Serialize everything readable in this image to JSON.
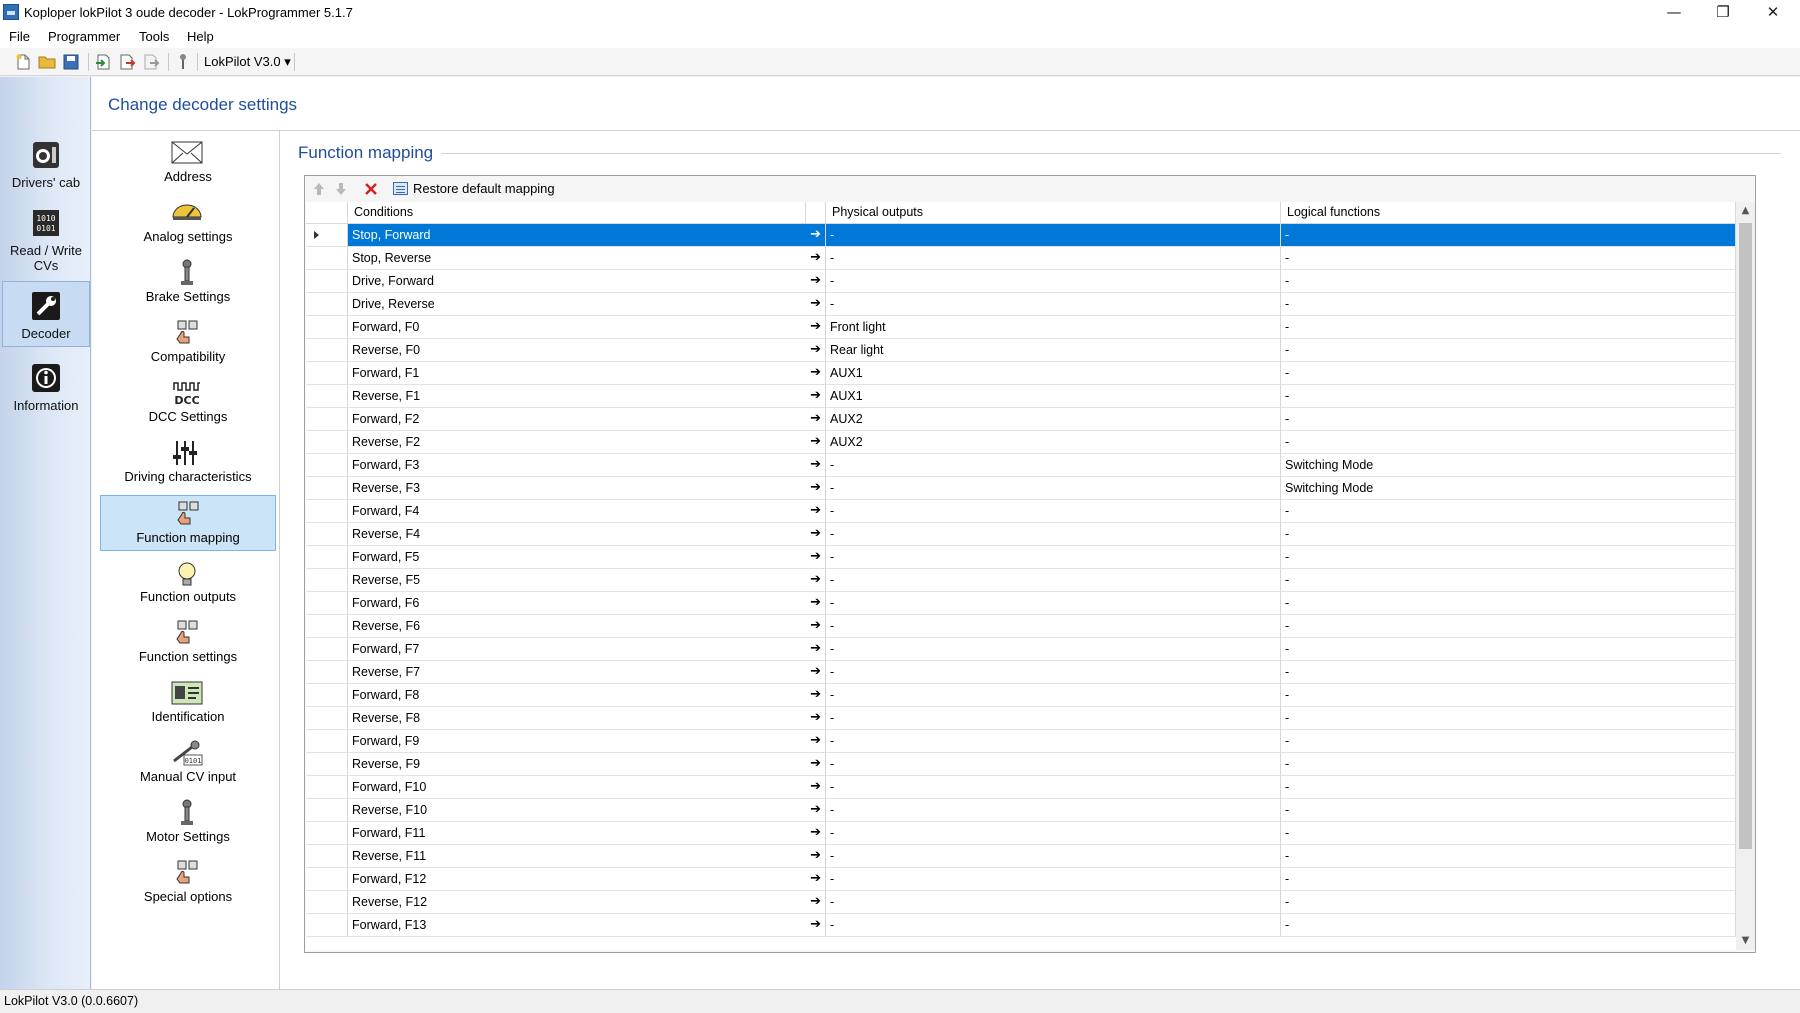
{
  "window": {
    "title": "Koploper lokPilot 3 oude decoder - LokProgrammer 5.1.7",
    "controls": {
      "minimize": "—",
      "restore": "❐",
      "close": "✕"
    }
  },
  "menu": [
    "File",
    "Programmer",
    "Tools",
    "Help"
  ],
  "toolbar": {
    "device_label": "LokPilot V3.0 ▾"
  },
  "leftbar": [
    {
      "label": "Drivers' cab",
      "icon": "drivers-cab-icon"
    },
    {
      "label": "Read / Write CVs",
      "icon": "read-write-cvs-icon"
    },
    {
      "label": "Decoder",
      "icon": "decoder-wrench-icon",
      "selected": true
    },
    {
      "label": "Information",
      "icon": "information-icon"
    }
  ],
  "page_title": "Change decoder settings",
  "settings_nav": [
    {
      "label": "Address",
      "icon": "envelope-icon"
    },
    {
      "label": "Analog settings",
      "icon": "gauge-icon"
    },
    {
      "label": "Brake Settings",
      "icon": "lever-icon"
    },
    {
      "label": "Compatibility",
      "icon": "function-keys-icon"
    },
    {
      "label": "DCC Settings",
      "icon": "dcc-icon"
    },
    {
      "label": "Driving characteristics",
      "icon": "sliders-icon"
    },
    {
      "label": "Function mapping",
      "icon": "function-keys-icon",
      "selected": true
    },
    {
      "label": "Function outputs",
      "icon": "bulb-icon"
    },
    {
      "label": "Function settings",
      "icon": "function-keys-icon"
    },
    {
      "label": "Identification",
      "icon": "id-card-icon"
    },
    {
      "label": "Manual CV input",
      "icon": "manual-cv-icon"
    },
    {
      "label": "Motor Settings",
      "icon": "lever-icon"
    },
    {
      "label": "Special options",
      "icon": "function-keys-icon"
    }
  ],
  "section_title": "Function mapping",
  "grid_toolbar": {
    "restore_label": "Restore default mapping"
  },
  "grid": {
    "headers": [
      "Conditions",
      "Physical outputs",
      "Logical functions"
    ],
    "arrow": "➔",
    "rows": [
      {
        "condition": "Stop, Forward",
        "physical": "-",
        "logical": "-",
        "selected": true
      },
      {
        "condition": "Stop, Reverse",
        "physical": "-",
        "logical": "-"
      },
      {
        "condition": "Drive, Forward",
        "physical": "-",
        "logical": "-"
      },
      {
        "condition": "Drive, Reverse",
        "physical": "-",
        "logical": "-"
      },
      {
        "condition": "Forward, F0",
        "physical": "Front light",
        "logical": "-"
      },
      {
        "condition": "Reverse, F0",
        "physical": "Rear light",
        "logical": "-"
      },
      {
        "condition": "Forward, F1",
        "physical": "AUX1",
        "logical": "-"
      },
      {
        "condition": "Reverse, F1",
        "physical": "AUX1",
        "logical": "-"
      },
      {
        "condition": "Forward, F2",
        "physical": "AUX2",
        "logical": "-"
      },
      {
        "condition": "Reverse, F2",
        "physical": "AUX2",
        "logical": "-"
      },
      {
        "condition": "Forward, F3",
        "physical": "-",
        "logical": "Switching Mode"
      },
      {
        "condition": "Reverse, F3",
        "physical": "-",
        "logical": "Switching Mode"
      },
      {
        "condition": "Forward, F4",
        "physical": "-",
        "logical": "-"
      },
      {
        "condition": "Reverse, F4",
        "physical": "-",
        "logical": "-"
      },
      {
        "condition": "Forward, F5",
        "physical": "-",
        "logical": "-"
      },
      {
        "condition": "Reverse, F5",
        "physical": "-",
        "logical": "-"
      },
      {
        "condition": "Forward, F6",
        "physical": "-",
        "logical": "-"
      },
      {
        "condition": "Reverse, F6",
        "physical": "-",
        "logical": "-"
      },
      {
        "condition": "Forward, F7",
        "physical": "-",
        "logical": "-"
      },
      {
        "condition": "Reverse, F7",
        "physical": "-",
        "logical": "-"
      },
      {
        "condition": "Forward, F8",
        "physical": "-",
        "logical": "-"
      },
      {
        "condition": "Reverse, F8",
        "physical": "-",
        "logical": "-"
      },
      {
        "condition": "Forward, F9",
        "physical": "-",
        "logical": "-"
      },
      {
        "condition": "Reverse, F9",
        "physical": "-",
        "logical": "-"
      },
      {
        "condition": "Forward, F10",
        "physical": "-",
        "logical": "-"
      },
      {
        "condition": "Reverse, F10",
        "physical": "-",
        "logical": "-"
      },
      {
        "condition": "Forward, F11",
        "physical": "-",
        "logical": "-"
      },
      {
        "condition": "Reverse, F11",
        "physical": "-",
        "logical": "-"
      },
      {
        "condition": "Forward, F12",
        "physical": "-",
        "logical": "-"
      },
      {
        "condition": "Reverse, F12",
        "physical": "-",
        "logical": "-"
      },
      {
        "condition": "Forward, F13",
        "physical": "-",
        "logical": "-"
      }
    ]
  },
  "statusbar": {
    "text": "LokPilot V3.0 (0.0.6607)"
  },
  "colors": {
    "accent": "#0078d7",
    "heading": "#1f4e9a",
    "leftbar": "#c3d3ea",
    "nav_selected": "#cce4f7"
  }
}
